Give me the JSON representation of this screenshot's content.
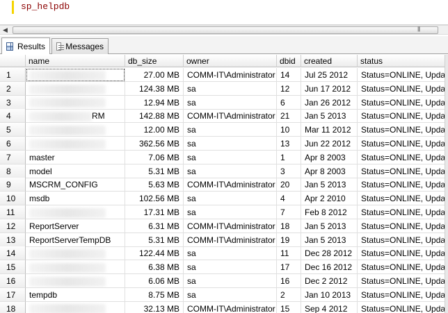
{
  "editor": {
    "query": "sp_helpdb"
  },
  "tabs": [
    {
      "label": "Results",
      "icon": "grid-icon",
      "active": true
    },
    {
      "label": "Messages",
      "icon": "messages-icon",
      "active": false
    }
  ],
  "grid": {
    "columns": [
      "",
      "name",
      "db_size",
      "owner",
      "dbid",
      "created",
      "status"
    ],
    "rows": [
      {
        "n": "1",
        "name": "",
        "size": "27.00 MB",
        "owner": "COMM-IT\\Administrator",
        "dbid": "14",
        "created": "Jul 25 2012",
        "status": "Status=ONLINE, Update"
      },
      {
        "n": "2",
        "name": "",
        "size": "124.38 MB",
        "owner": "sa",
        "dbid": "12",
        "created": "Jun 17 2012",
        "status": "Status=ONLINE, Update"
      },
      {
        "n": "3",
        "name": "",
        "size": "12.94 MB",
        "owner": "sa",
        "dbid": "6",
        "created": "Jan 26 2012",
        "status": "Status=ONLINE, Update"
      },
      {
        "n": "4",
        "name": "RM",
        "size": "142.88 MB",
        "owner": "COMM-IT\\Administrator",
        "dbid": "21",
        "created": "Jan  5 2013",
        "status": "Status=ONLINE, Update"
      },
      {
        "n": "5",
        "name": "",
        "size": "12.00 MB",
        "owner": "sa",
        "dbid": "10",
        "created": "Mar 11 2012",
        "status": "Status=ONLINE, Update"
      },
      {
        "n": "6",
        "name": "",
        "size": "362.56 MB",
        "owner": "sa",
        "dbid": "13",
        "created": "Jun 22 2012",
        "status": "Status=ONLINE, Update"
      },
      {
        "n": "7",
        "name": "master",
        "size": "7.06 MB",
        "owner": "sa",
        "dbid": "1",
        "created": "Apr  8 2003",
        "status": "Status=ONLINE, Update"
      },
      {
        "n": "8",
        "name": "model",
        "size": "5.31 MB",
        "owner": "sa",
        "dbid": "3",
        "created": "Apr  8 2003",
        "status": "Status=ONLINE, Update"
      },
      {
        "n": "9",
        "name": "MSCRM_CONFIG",
        "size": "5.63 MB",
        "owner": "COMM-IT\\Administrator",
        "dbid": "20",
        "created": "Jan  5 2013",
        "status": "Status=ONLINE, Update"
      },
      {
        "n": "10",
        "name": "msdb",
        "size": "102.56 MB",
        "owner": "sa",
        "dbid": "4",
        "created": "Apr  2 2010",
        "status": "Status=ONLINE, Update"
      },
      {
        "n": "11",
        "name": "",
        "size": "17.31 MB",
        "owner": "sa",
        "dbid": "7",
        "created": "Feb  8 2012",
        "status": "Status=ONLINE, Update"
      },
      {
        "n": "12",
        "name": "ReportServer",
        "size": "6.31 MB",
        "owner": "COMM-IT\\Administrator",
        "dbid": "18",
        "created": "Jan  5 2013",
        "status": "Status=ONLINE, Update"
      },
      {
        "n": "13",
        "name": "ReportServerTempDB",
        "size": "5.31 MB",
        "owner": "COMM-IT\\Administrator",
        "dbid": "19",
        "created": "Jan  5 2013",
        "status": "Status=ONLINE, Update"
      },
      {
        "n": "14",
        "name": "",
        "size": "122.44 MB",
        "owner": "sa",
        "dbid": "11",
        "created": "Dec 28 2012",
        "status": "Status=ONLINE, Update"
      },
      {
        "n": "15",
        "name": "",
        "size": "6.38 MB",
        "owner": "sa",
        "dbid": "17",
        "created": "Dec 16 2012",
        "status": "Status=ONLINE, Update"
      },
      {
        "n": "16",
        "name": "",
        "size": "6.06 MB",
        "owner": "sa",
        "dbid": "16",
        "created": "Dec  2 2012",
        "status": "Status=ONLINE, Update"
      },
      {
        "n": "17",
        "name": "tempdb",
        "size": "8.75 MB",
        "owner": "sa",
        "dbid": "2",
        "created": "Jan 10 2013",
        "status": "Status=ONLINE, Update"
      },
      {
        "n": "18",
        "name": "",
        "size": "32.13 MB",
        "owner": "COMM-IT\\Administrator",
        "dbid": "15",
        "created": "Sep  4 2012",
        "status": "Status=ONLINE, Update"
      }
    ]
  }
}
